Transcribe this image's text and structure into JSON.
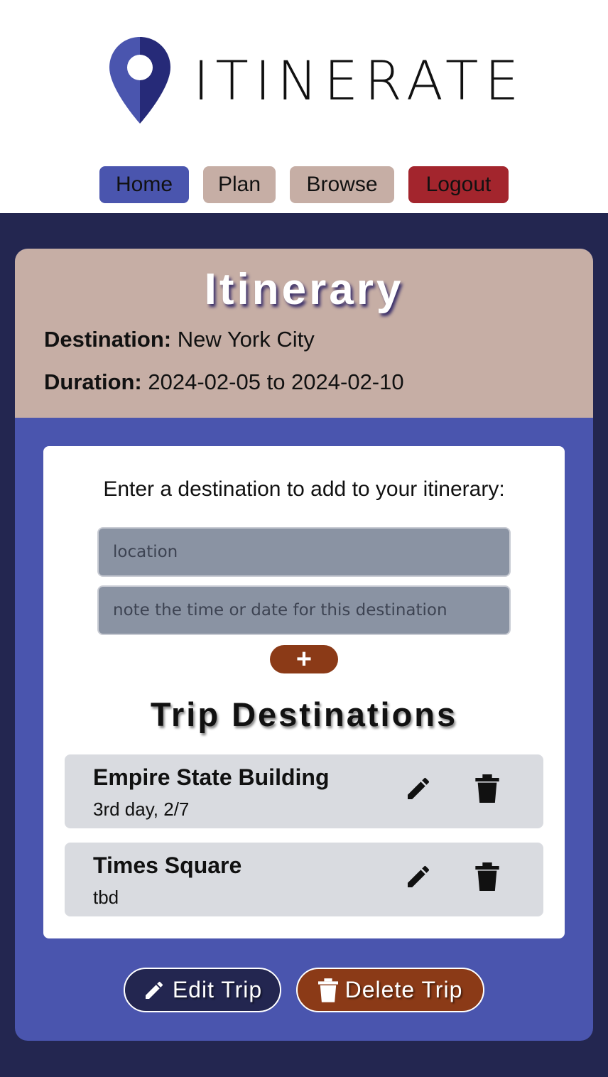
{
  "header": {
    "app_name": "ITINERATE",
    "logo_icon": "map-pin-icon"
  },
  "nav": {
    "home": "Home",
    "plan": "Plan",
    "browse": "Browse",
    "logout": "Logout"
  },
  "itinerary": {
    "title": "Itinerary",
    "destination_label": "Destination:",
    "destination_value": "New York City",
    "duration_label": "Duration:",
    "duration_value": "2024-02-05 to 2024-02-10"
  },
  "add_form": {
    "prompt": "Enter a destination to add to your itinerary:",
    "location_placeholder": "location",
    "note_placeholder": "note the time or date for this destination",
    "add_label": "+"
  },
  "destinations": {
    "title": "Trip Destinations",
    "items": [
      {
        "name": "Empire State Building",
        "note": "3rd day, 2/7"
      },
      {
        "name": "Times Square",
        "note": "tbd"
      }
    ]
  },
  "actions": {
    "edit_trip": "Edit Trip",
    "delete_trip": "Delete Trip"
  },
  "colors": {
    "primary": "#4a55ae",
    "dark_bg": "#232650",
    "tan": "#c6aea5",
    "danger": "#a3252d",
    "rust": "#8b3a17"
  }
}
